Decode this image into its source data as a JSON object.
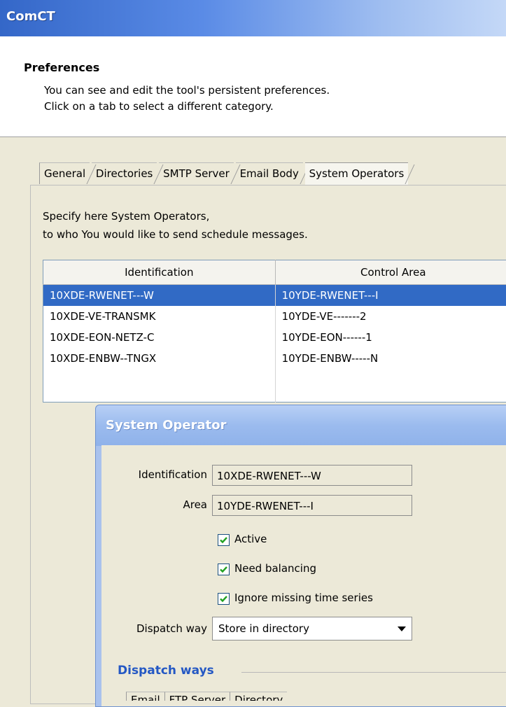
{
  "window": {
    "title": "ComCT"
  },
  "header": {
    "title": "Preferences",
    "line1": "You can see and edit the tool's persistent preferences.",
    "line2": "Click on a tab to select a different category."
  },
  "tabs": [
    "General",
    "Directories",
    "SMTP Server",
    "Email Body",
    "System Operators"
  ],
  "active_tab": "System Operators",
  "panel": {
    "desc1": "Specify here System Operators,",
    "desc2": "to who You would like to send schedule messages."
  },
  "table": {
    "columns": [
      "Identification",
      "Control Area"
    ],
    "rows": [
      [
        "10XDE-RWENET---W",
        "10YDE-RWENET---I"
      ],
      [
        "10XDE-VE-TRANSMK",
        "10YDE-VE-------2"
      ],
      [
        "10XDE-EON-NETZ-C",
        "10YDE-EON------1"
      ],
      [
        "10XDE-ENBW--TNGX",
        "10YDE-ENBW-----N"
      ]
    ],
    "selected_row": 0
  },
  "dialog": {
    "title": "System Operator",
    "identification_label": "Identification",
    "identification_value": "10XDE-RWENET---W",
    "area_label": "Area",
    "area_value": "10YDE-RWENET---I",
    "checkboxes": [
      {
        "label": "Active",
        "checked": true
      },
      {
        "label": "Need balancing",
        "checked": true
      },
      {
        "label": "Ignore missing time series",
        "checked": true
      }
    ],
    "dispatch_label": "Dispatch way",
    "dispatch_value": "Store in directory",
    "section_title": "Dispatch ways",
    "subtabs": [
      "Email",
      "FTP Server",
      "Directory"
    ]
  },
  "colors": {
    "selection": "#316ac5",
    "section_title": "#2458c4",
    "title_bar": "#3467c8"
  }
}
